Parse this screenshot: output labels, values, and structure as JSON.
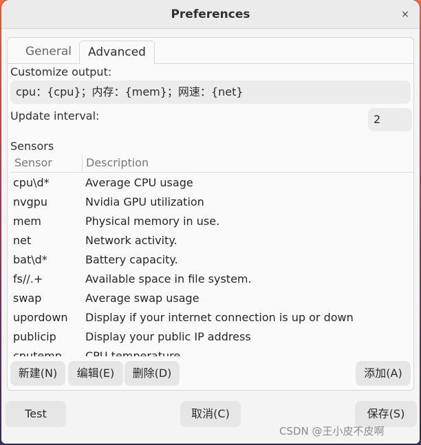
{
  "window": {
    "title": "Preferences",
    "close_glyph": "×"
  },
  "tabs": [
    {
      "label": "General",
      "active": false
    },
    {
      "label": "Advanced",
      "active": true
    }
  ],
  "advanced": {
    "output_label": "Customize output:",
    "output_value": "cpu：{cpu}；内存：{mem}；网速：{net}",
    "interval_label": "Update interval:",
    "interval_value": "2",
    "sensors_label": "Sensors",
    "table": {
      "headers": [
        "Sensor",
        "Description"
      ],
      "rows": [
        {
          "sensor": "cpu\\d*",
          "description": "Average CPU usage"
        },
        {
          "sensor": "nvgpu",
          "description": "Nvidia GPU utilization"
        },
        {
          "sensor": "mem",
          "description": "Physical memory in use."
        },
        {
          "sensor": "net",
          "description": "Network activity."
        },
        {
          "sensor": "bat\\d*",
          "description": "Battery capacity."
        },
        {
          "sensor": "fs//.+",
          "description": "Available space in file system."
        },
        {
          "sensor": "swap",
          "description": "Average swap usage"
        },
        {
          "sensor": "upordown",
          "description": "Display if your internet connection is up or down"
        },
        {
          "sensor": "publicip",
          "description": "Display your public IP address"
        },
        {
          "sensor": "cputemp",
          "description": "CPU temperature"
        }
      ]
    },
    "buttons": {
      "new": "新建(N)",
      "edit": "编辑(E)",
      "delete": "删除(D)",
      "add": "添加(A)"
    }
  },
  "footer": {
    "test": "Test",
    "cancel": "取消(C)",
    "save": "保存(S)"
  },
  "watermark": "CSDN @王小皮不皮啊",
  "colors": {
    "window_bg": "#f4f4f4",
    "entry_bg": "#ececec",
    "button_bg": "#e6e6e6"
  }
}
